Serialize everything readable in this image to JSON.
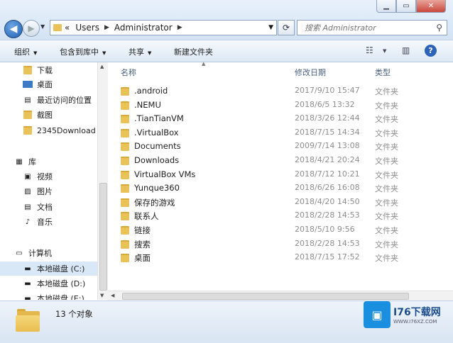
{
  "address": {
    "crumbs": [
      "Users",
      "Administrator"
    ],
    "prefix": "«"
  },
  "search": {
    "placeholder": "搜索 Administrator"
  },
  "toolbar": {
    "organize": "组织",
    "include_in_library": "包含到库中",
    "share": "共享",
    "new_folder": "新建文件夹"
  },
  "nav": {
    "favorites": [
      {
        "label": "下载",
        "icon": "download-folder-icon"
      },
      {
        "label": "桌面",
        "icon": "desktop-icon"
      },
      {
        "label": "最近访问的位置",
        "icon": "recent-places-icon"
      },
      {
        "label": "截图",
        "icon": "folder-icon"
      },
      {
        "label": "2345Download",
        "icon": "folder-icon"
      }
    ],
    "libraries_label": "库",
    "libraries": [
      {
        "label": "视频",
        "icon": "video-icon"
      },
      {
        "label": "图片",
        "icon": "pictures-icon"
      },
      {
        "label": "文档",
        "icon": "documents-icon"
      },
      {
        "label": "音乐",
        "icon": "music-icon"
      }
    ],
    "computer_label": "计算机",
    "drives": [
      {
        "label": "本地磁盘 (C:)"
      },
      {
        "label": "本地磁盘 (D:)"
      },
      {
        "label": "本地磁盘 (E:)"
      }
    ]
  },
  "columns": {
    "name": "名称",
    "date": "修改日期",
    "type": "类型"
  },
  "files": [
    {
      "name": ".android",
      "date": "2017/9/10 15:47",
      "type": "文件夹"
    },
    {
      "name": ".NEMU",
      "date": "2018/6/5 13:32",
      "type": "文件夹"
    },
    {
      "name": ".TianTianVM",
      "date": "2018/3/26 12:44",
      "type": "文件夹"
    },
    {
      "name": ".VirtualBox",
      "date": "2018/7/15 14:34",
      "type": "文件夹"
    },
    {
      "name": "Documents",
      "date": "2009/7/14 13:08",
      "type": "文件夹"
    },
    {
      "name": "Downloads",
      "date": "2018/4/21 20:24",
      "type": "文件夹"
    },
    {
      "name": "VirtualBox VMs",
      "date": "2018/7/12 10:21",
      "type": "文件夹"
    },
    {
      "name": "Yunque360",
      "date": "2018/6/26 16:08",
      "type": "文件夹"
    },
    {
      "name": "保存的游戏",
      "date": "2018/4/20 14:50",
      "type": "文件夹"
    },
    {
      "name": "联系人",
      "date": "2018/2/28 14:53",
      "type": "文件夹"
    },
    {
      "name": "链接",
      "date": "2018/5/10 9:56",
      "type": "文件夹"
    },
    {
      "name": "搜索",
      "date": "2018/2/28 14:53",
      "type": "文件夹"
    },
    {
      "name": "桌面",
      "date": "2018/7/15 17:52",
      "type": "文件夹"
    }
  ],
  "status": {
    "count": "13 个对象"
  },
  "watermark": {
    "main": "I76下载网",
    "sub": "WWW.I76XZ.COM"
  }
}
